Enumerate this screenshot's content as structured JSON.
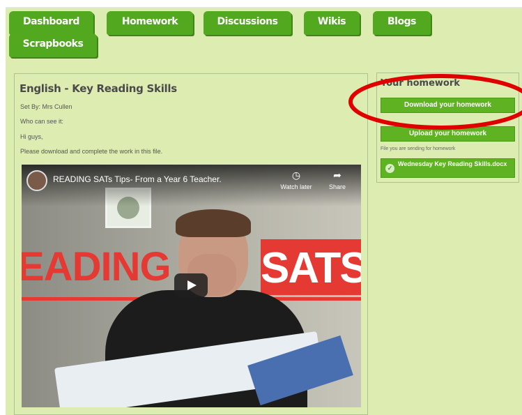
{
  "nav": {
    "tabs": [
      "Dashboard",
      "Homework",
      "Discussions",
      "Wikis",
      "Blogs",
      "Scrapbooks"
    ]
  },
  "homework": {
    "title": "English - Key Reading Skills",
    "set_by": "Set By: Mrs Cullen",
    "who": "Who can see it:",
    "greeting": "Hi guys,",
    "instruction": "Please download and complete the work in this file."
  },
  "video": {
    "title": "READING SATs Tips- From a Year 6 Teacher.",
    "watch_later": "Watch later",
    "share": "Share",
    "banner_left": "EADING",
    "banner_right": "SATS"
  },
  "sidebar": {
    "title": "Your homework",
    "download_label": "Download your homework",
    "upload_label": "Upload your homework",
    "note": "File you are sending for homework",
    "file_name": "Wednesday Key Reading Skills.docx"
  },
  "colors": {
    "page_bg": "#ddecb1",
    "tab_green": "#52a81f",
    "button_green": "#5fb322",
    "annotation_red": "#e00000"
  }
}
